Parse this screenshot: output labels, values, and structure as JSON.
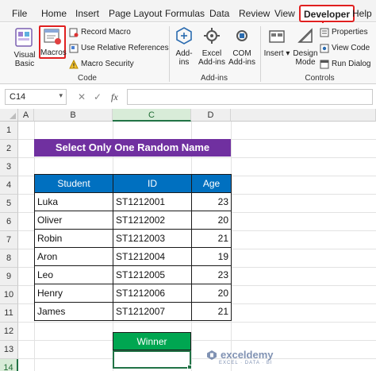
{
  "menu": {
    "tabs": [
      "File",
      "Home",
      "Insert",
      "Page Layout",
      "Formulas",
      "Data",
      "Review",
      "View",
      "Developer",
      "Help"
    ],
    "active": "Developer"
  },
  "ribbon": {
    "code": {
      "visual_basic": "Visual Basic",
      "macros": "Macros",
      "record_macro": "Record Macro",
      "use_relative": "Use Relative References",
      "macro_security": "Macro Security",
      "label": "Code"
    },
    "addins": {
      "addins": "Add-ins",
      "excel_addins": "Excel Add-ins",
      "com_addins": "COM Add-ins",
      "label": "Add-ins"
    },
    "controls": {
      "insert": "Insert",
      "design_mode": "Design Mode",
      "properties": "Properties",
      "view_code": "View Code",
      "run_dialog": "Run Dialog",
      "label": "Controls"
    }
  },
  "formula_bar": {
    "name_box": "C14",
    "fx": "fx",
    "cancel": "✕",
    "enter": "✓",
    "value": ""
  },
  "grid": {
    "columns": [
      "A",
      "B",
      "C",
      "D"
    ],
    "selected_column": "C",
    "rows": [
      "1",
      "2",
      "3",
      "4",
      "5",
      "6",
      "7",
      "8",
      "9",
      "10",
      "11",
      "12",
      "13",
      "14"
    ],
    "selected_row": "14"
  },
  "sheet": {
    "title": "Select Only One Random Name",
    "headers": [
      "Student",
      "ID",
      "Age"
    ],
    "rows": [
      [
        "Luka",
        "ST1212001",
        "23"
      ],
      [
        "Oliver",
        "ST1212002",
        "20"
      ],
      [
        "Robin",
        "ST1212003",
        "21"
      ],
      [
        "Aron",
        "ST1212004",
        "19"
      ],
      [
        "Leo",
        "ST1212005",
        "23"
      ],
      [
        "Henry",
        "ST1212006",
        "20"
      ],
      [
        "James",
        "ST1212007",
        "21"
      ]
    ],
    "winner_label": "Winner",
    "winner_value": ""
  },
  "watermark": {
    "name": "exceldemy",
    "tagline": "EXCEL · DATA · BI"
  },
  "colors": {
    "title_bg": "#7030a0",
    "header_bg": "#0070c0",
    "winner_bg": "#00a651",
    "highlight": "#e02020",
    "excel_green": "#217346"
  }
}
